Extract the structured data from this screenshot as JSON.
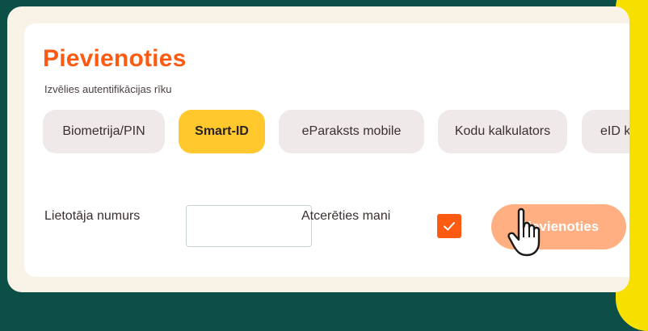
{
  "header": {
    "title": "Pievienoties",
    "subtitle": "Izvēlies autentifikācijas rīku"
  },
  "tabs": [
    {
      "label": "Biometrija/PIN",
      "active": false
    },
    {
      "label": "Smart-ID",
      "active": true
    },
    {
      "label": "eParaksts mobile",
      "active": false
    },
    {
      "label": "Kodu kalkulators",
      "active": false
    },
    {
      "label": "eID ka",
      "active": false
    }
  ],
  "form": {
    "user_number_label": "Lietotāja numurs",
    "user_number_value": "",
    "remember_label": "Atcerēties mani",
    "remember_checked": true,
    "submit_label": "Pievienoties"
  },
  "colors": {
    "accent_orange": "#ff5a12",
    "active_tab_yellow": "#ffc82c",
    "button_disabled": "#ffaf82",
    "background_green": "#0b4f47"
  },
  "icons": [
    "checkmark-icon",
    "hand-pointer-icon"
  ]
}
